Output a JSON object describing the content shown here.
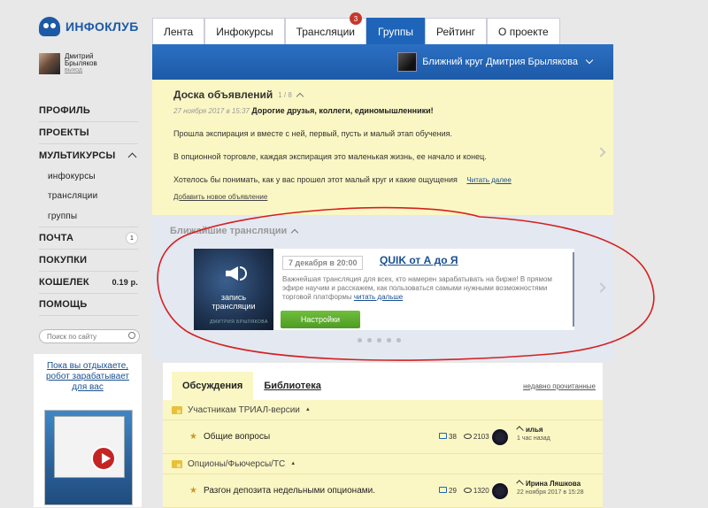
{
  "logo": {
    "text": "ИНФОКЛУБ"
  },
  "user": {
    "name_line1": "Дмитрий",
    "name_line2": "Брыляков",
    "logout": "выход"
  },
  "menu": {
    "profile": "ПРОФИЛЬ",
    "projects": "ПРОЕКТЫ",
    "multicourses": "МУЛЬТИКУРСЫ",
    "sub": [
      "инфокурсы",
      "трансляции",
      "группы"
    ],
    "mail": "ПОЧТА",
    "mail_count": "1",
    "purchases": "ПОКУПКИ",
    "wallet": "КОШЕЛЕК",
    "wallet_balance": "0.19 р.",
    "help": "ПОМОЩЬ"
  },
  "search": {
    "placeholder": "Поиск по сайту"
  },
  "promo": {
    "text": "Пока вы отдыхаете, робот зарабатывает для вас"
  },
  "tabs": [
    {
      "label": "Лента"
    },
    {
      "label": "Инфокурсы"
    },
    {
      "label": "Трансляции",
      "badge": "3"
    },
    {
      "label": "Группы"
    },
    {
      "label": "Рейтинг"
    },
    {
      "label": "О проекте"
    }
  ],
  "group": {
    "name": "Ближний круг Дмитрия Брылякова"
  },
  "board": {
    "title": "Доска объявлений",
    "counter": "1 / 8",
    "date": "27 ноября 2017 в 15:37",
    "headline": "Дорогие друзья, коллеги, единомышленники!",
    "p1": "Прошла экспирация и вместе с ней, первый, пусть и малый этап обучения.",
    "p2": "В опционной торговле, каждая экспирация это маленькая жизнь, ее начало и конец.",
    "p3": "Хотелось бы понимать, как у вас прошел этот малый круг и какие ощущения",
    "read_more": "Читать далее",
    "add": "Добавить новое объявление"
  },
  "broadcasts": {
    "title": "Ближайшие трансляции",
    "thumb_line1": "запись",
    "thumb_line2": "трансляции",
    "thumb_sub": "ДМИТРИЯ БРЫЛЯКОВА",
    "date": "7 декабря в 20:00",
    "name": "QUIK от А до Я",
    "desc": "Важнейшая трансляция для всех, кто намерен зарабатывать на бирже! В прямом эфире научим и расскажем, как пользоваться самыми нужными возможностями торговой платформы",
    "more": "читать дальше",
    "settings": "Настройки"
  },
  "forum": {
    "tab_discussions": "Обсуждения",
    "tab_library": "Библиотека",
    "recent": "недавно прочитанные",
    "categories": [
      {
        "name": "Участникам ТРИАЛ-версии",
        "topics": [
          {
            "title": "Общие вопросы",
            "comments": "38",
            "views": "2103",
            "user": "илья",
            "time": "1 час назад"
          }
        ]
      },
      {
        "name": "Опционы/Фьючерсы/ТС",
        "topics": [
          {
            "title": "Разгон депозита недельными опционами.",
            "comments": "29",
            "views": "1320",
            "user": "Ирина Ляшкова",
            "time": "22 ноября 2017 в 15:28"
          }
        ]
      }
    ]
  },
  "colors": {
    "accent": "#1e65b9",
    "board_bg": "#fbf7c4",
    "broadcast_bg": "#e3e8f1",
    "badge": "#c5392d",
    "settings_btn": "#5aae2e"
  }
}
